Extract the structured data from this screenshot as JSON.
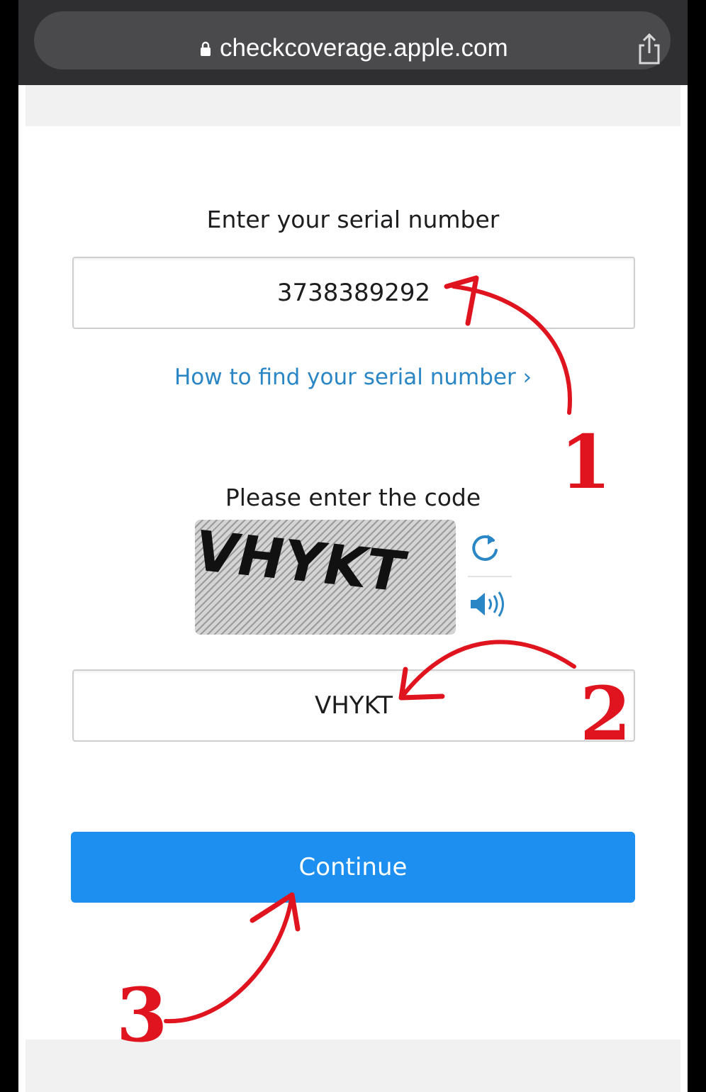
{
  "browser": {
    "url": "checkcoverage.apple.com"
  },
  "form": {
    "serial_label": "Enter your serial number",
    "serial_value": "3738389292",
    "help_link": "How to find your serial number ›",
    "code_label": "Please enter the code",
    "captcha_text": "VHYKT",
    "code_value": "VHYKT",
    "continue_label": "Continue"
  },
  "annotations": {
    "step_1": "1",
    "step_2": "2",
    "step_3": "3",
    "arrow_color": "#e0141e"
  },
  "colors": {
    "link": "#2a86c4",
    "button": "#1d8ff0",
    "browser_bar": "#2f2f31"
  }
}
